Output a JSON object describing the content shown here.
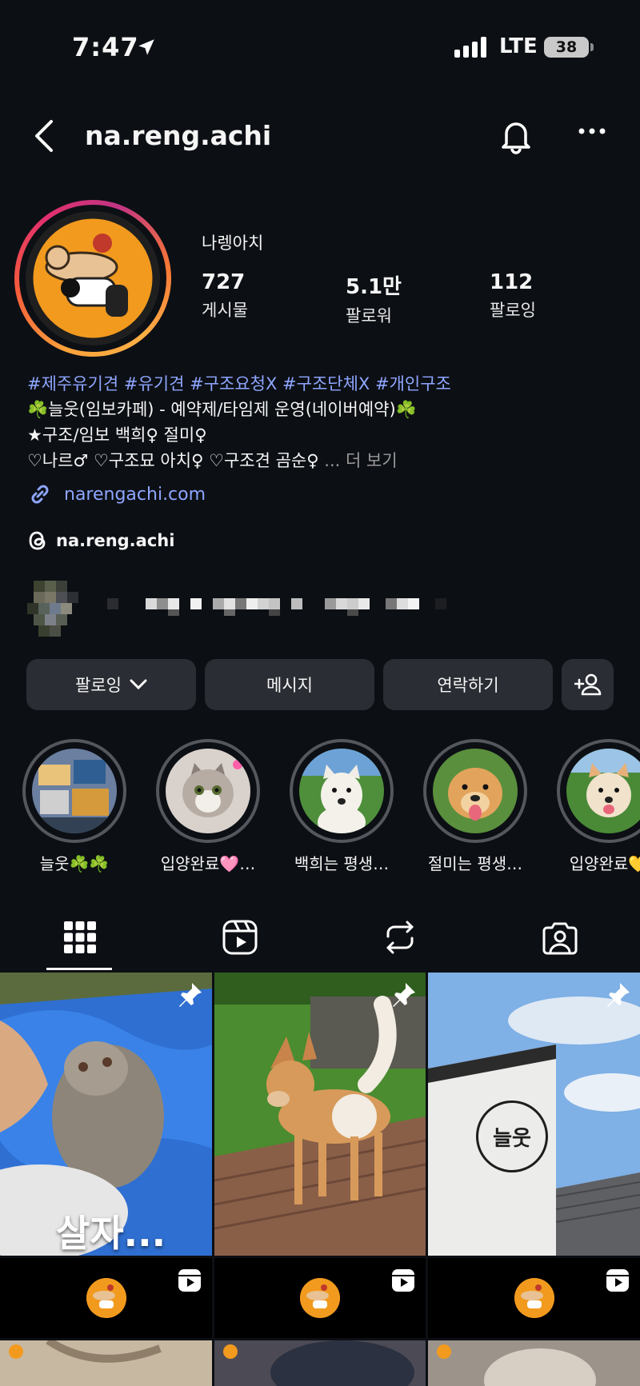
{
  "status_bar": {
    "time": "7:47",
    "network": "LTE",
    "battery": "38"
  },
  "nav": {
    "username": "na.reng.achi"
  },
  "profile": {
    "display_name": "나렝아치",
    "stats": [
      {
        "value": "727",
        "label": "게시물"
      },
      {
        "value": "5.1만",
        "label": "팔로워"
      },
      {
        "value": "112",
        "label": "팔로잉"
      }
    ]
  },
  "bio": {
    "hashtags": "#제주유기견 #유기견 #구조요청X #구조단체X #개인구조",
    "line2": "☘️늘웃(임보카페) - 예약제/타임제 운영(네이버예약)☘️",
    "line3": "★구조/임보 백희♀ 절미♀",
    "line4": "♡나르♂ ♡구조묘 아치♀ ♡구조견 곰순♀",
    "more": "... 더 보기",
    "link": "narengachi.com",
    "threads_handle": "na.reng.achi"
  },
  "actions": {
    "follow": "팔로잉",
    "message": "메시지",
    "contact": "연락하기"
  },
  "highlights": [
    {
      "label": "늘웃☘️☘️"
    },
    {
      "label": "입양완료🩷…"
    },
    {
      "label": "백희는 평생…"
    },
    {
      "label": "절미는 평생…"
    },
    {
      "label": "입양완료💛"
    }
  ],
  "posts": [
    {
      "caption": "살자..."
    },
    {
      "caption": ""
    },
    {
      "caption": "",
      "logo_text": "늘웃"
    }
  ],
  "colors": {
    "background": "#0c0f14",
    "link": "#8ea6ff",
    "button": "#2a2d33",
    "avatar_bg": "#f29a1e"
  }
}
